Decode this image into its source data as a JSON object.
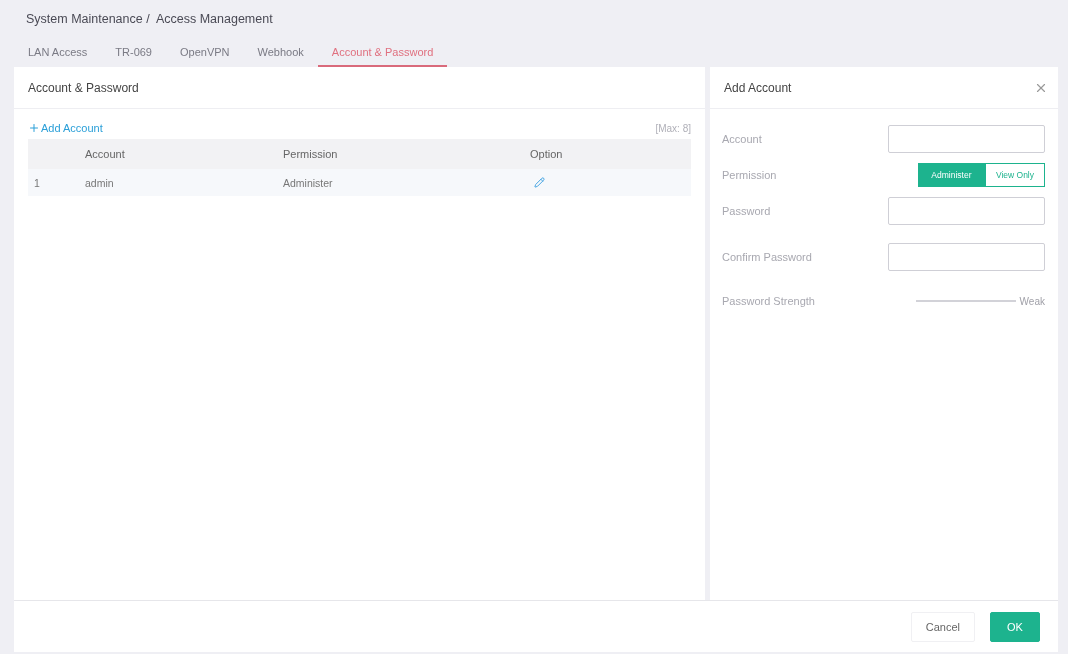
{
  "breadcrumb": "System Maintenance /  Access Management",
  "tabs": [
    {
      "label": "LAN Access",
      "selected": false
    },
    {
      "label": "TR-069",
      "selected": false
    },
    {
      "label": "OpenVPN",
      "selected": false
    },
    {
      "label": "Webhook",
      "selected": false
    },
    {
      "label": "Account & Password",
      "selected": true
    }
  ],
  "panel": {
    "title": "Account & Password",
    "add_button": "Add Account",
    "max_note": "[Max: 8]",
    "table": {
      "columns": [
        "Account",
        "Permission",
        "Option"
      ],
      "rows": [
        {
          "index": "1",
          "account": "admin",
          "permission": "Administer"
        }
      ]
    }
  },
  "dialog": {
    "title": "Add Account",
    "fields": [
      {
        "kind": "input",
        "label": "Account"
      },
      {
        "kind": "segmented",
        "label": "Permission",
        "options": [
          {
            "label": "Administer",
            "selected": true
          },
          {
            "label": "View Only",
            "selected": false
          }
        ]
      },
      {
        "kind": "input",
        "label": "Password"
      },
      {
        "kind": "input",
        "label": "Confirm Password"
      },
      {
        "kind": "strength",
        "label": "Password Strength",
        "reading": "Weak"
      }
    ]
  },
  "footer": {
    "buttons": [
      {
        "label": "Cancel",
        "kind": "secondary"
      },
      {
        "label": "OK",
        "kind": "primary"
      }
    ]
  }
}
